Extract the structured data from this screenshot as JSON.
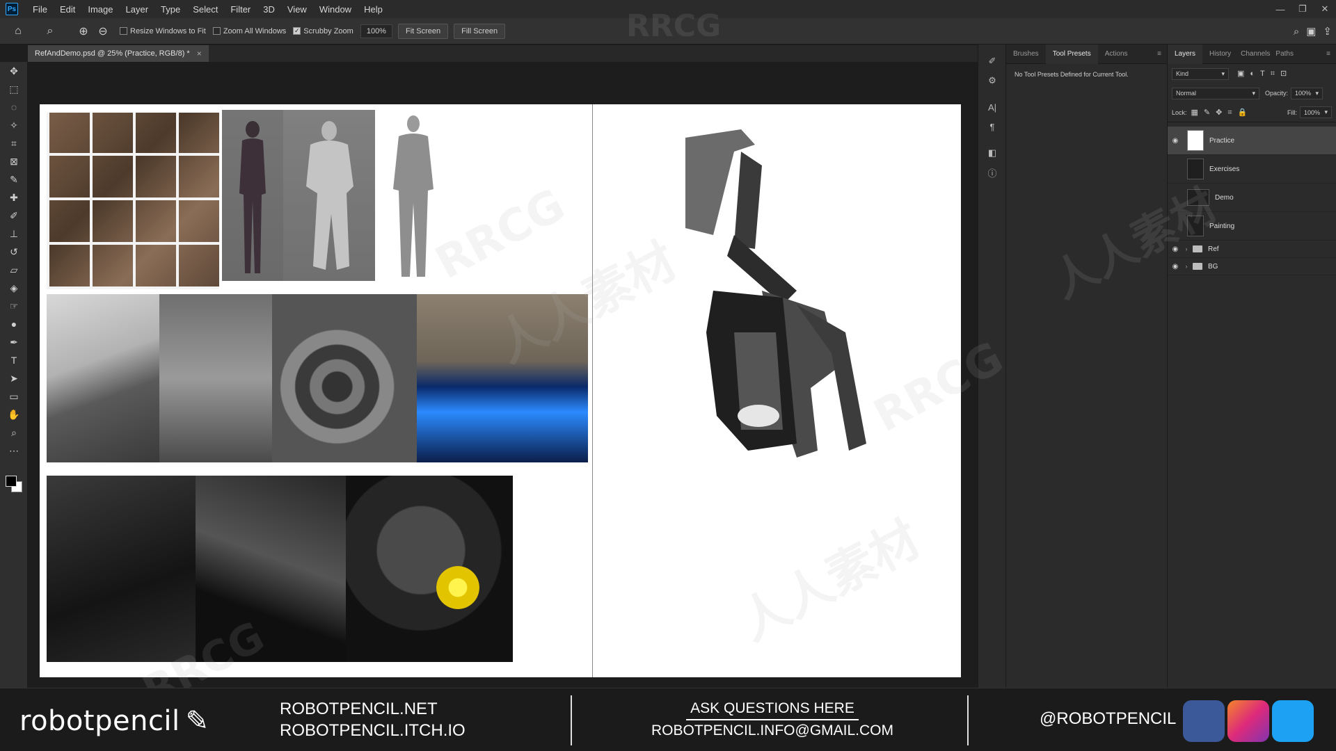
{
  "menubar": {
    "logo": "Ps",
    "items": [
      "File",
      "Edit",
      "Image",
      "Layer",
      "Type",
      "Select",
      "Filter",
      "3D",
      "View",
      "Window",
      "Help"
    ],
    "window_controls": [
      "—",
      "❐",
      "✕"
    ]
  },
  "options": {
    "resize_windows": "Resize Windows to Fit",
    "zoom_all": "Zoom All Windows",
    "scrubby_zoom": "Scrubby Zoom",
    "zoom_value": "100%",
    "fit_screen": "Fit Screen",
    "fill_screen": "Fill Screen"
  },
  "document": {
    "tab_title": "RefAndDemo.psd @ 25% (Practice, RGB/8) *"
  },
  "presets_panel": {
    "tabs": [
      "Brushes",
      "Tool Presets",
      "Actions"
    ],
    "message": "No Tool Presets Defined for Current Tool."
  },
  "layers_panel": {
    "tabs": [
      "Layers",
      "History",
      "Channels",
      "Paths"
    ],
    "filter_kind": "Kind",
    "blend_mode": "Normal",
    "opacity_label": "Opacity:",
    "opacity_value": "100%",
    "lock_label": "Lock:",
    "fill_label": "Fill:",
    "fill_value": "100%",
    "layers": [
      {
        "name": "Practice",
        "visible": true,
        "selected": true
      },
      {
        "name": "Exercises",
        "visible": false,
        "selected": false
      },
      {
        "name": "Demo",
        "visible": false,
        "selected": false
      },
      {
        "name": "Painting",
        "visible": false,
        "selected": false
      }
    ],
    "groups": [
      {
        "name": "Ref",
        "visible": true
      },
      {
        "name": "BG",
        "visible": true
      }
    ]
  },
  "banner": {
    "brand": "robotpencil",
    "url1": "ROBOTPENCIL.NET",
    "url2": "ROBOTPENCIL.ITCH.IO",
    "ask_title": "ASK QUESTIONS HERE",
    "email": "ROBOTPENCIL.INFO@GMAIL.COM",
    "handle": "@ROBOTPENCIL"
  },
  "watermark": {
    "latin": "RRCG",
    "cjk": "人人素材"
  },
  "colors": {
    "accent": "#31a8ff",
    "panel_bg": "#2b2b2b",
    "canvas_bg": "#1d1d1d"
  }
}
